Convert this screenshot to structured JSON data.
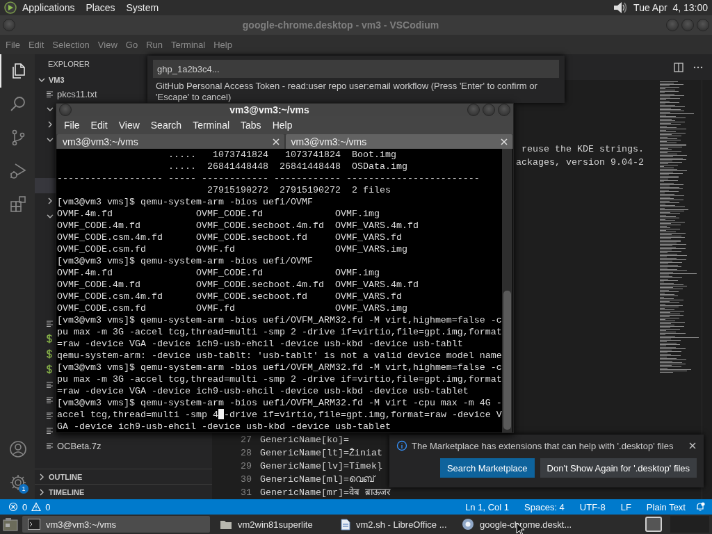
{
  "top_panel": {
    "menus": [
      "Applications",
      "Places",
      "System"
    ],
    "clock": "Tue Apr  4, 13:00"
  },
  "editor_window": {
    "title": "google-chrome.desktop - vm3 - VSCodium",
    "menus": [
      "File",
      "Edit",
      "Selection",
      "View",
      "Go",
      "Run",
      "Terminal",
      "Help"
    ],
    "activity_bar": [
      {
        "kind": "files",
        "selected": true
      },
      {
        "kind": "search",
        "selected": false
      },
      {
        "kind": "source-control",
        "selected": false
      },
      {
        "kind": "run",
        "selected": false
      },
      {
        "kind": "extensions",
        "selected": false
      }
    ],
    "settings_badge": "1",
    "sidebar": {
      "title": "EXPLORER",
      "folder": "VM3",
      "folder_expanded": true,
      "rows": [
        {
          "kind": "file",
          "label": "pkcs11.txt",
          "selected": false
        },
        {
          "kind": "folder",
          "expanded": true,
          "selected": false
        },
        {
          "kind": "folder",
          "expanded": false,
          "selected": false
        },
        {
          "kind": "folder",
          "expanded": true,
          "selected": false
        },
        {
          "kind": "covered",
          "selected": false
        },
        {
          "kind": "covered",
          "selected": false
        },
        {
          "kind": "covered",
          "selected": true
        },
        {
          "kind": "folder",
          "expanded": false,
          "selected": false
        },
        {
          "kind": "folder",
          "expanded": true,
          "selected": false
        },
        {
          "kind": "covered",
          "selected": false
        },
        {
          "kind": "covered",
          "selected": false
        },
        {
          "kind": "covered",
          "selected": false
        },
        {
          "kind": "covered",
          "selected": false
        },
        {
          "kind": "covered",
          "selected": false
        },
        {
          "kind": "covered",
          "selected": false
        },
        {
          "kind": "file",
          "selected": false
        },
        {
          "kind": "shell",
          "selected": false
        },
        {
          "kind": "shell",
          "selected": false
        },
        {
          "kind": "shell",
          "selected": false
        },
        {
          "kind": "file",
          "selected": false
        },
        {
          "kind": "file",
          "selected": false
        },
        {
          "kind": "file",
          "selected": false
        },
        {
          "kind": "file",
          "selected": false
        },
        {
          "kind": "file",
          "label": "OCBeta.7z",
          "selected": false
        }
      ],
      "sections": [
        {
          "label": "OUTLINE",
          "expanded": false
        },
        {
          "label": "TIMELINE",
          "expanded": false
        }
      ]
    },
    "editor": {
      "fragments": [
        "reuse the KDE strings.",
        "ackages, version 9.04-2"
      ],
      "lines": [
        {
          "number": "27",
          "text": "GenericName[ko]="
        },
        {
          "number": "28",
          "text": "GenericName[lt]=Žiniat"
        },
        {
          "number": "29",
          "text": "GenericName[lv]=Tīmekļ"
        },
        {
          "number": "30",
          "text": "GenericName[ml]=വെബ്"
        },
        {
          "number": "31",
          "text": "GenericName[mr]=वेब ब्राऊजर"
        }
      ]
    },
    "quick_input": {
      "value": "ghp_1a2b3c4...",
      "message": "GitHub Personal Access Token - read:user repo user:email workflow (Press 'Enter' to confirm or 'Escape' to cancel)"
    },
    "notification": {
      "message": "The Marketplace has extensions that can help with '.desktop' files",
      "buttons": [
        {
          "label": "Search Marketplace",
          "kind": "primary"
        },
        {
          "label": "Don't Show Again for '.desktop' files",
          "kind": "secondary"
        }
      ]
    },
    "status_bar": {
      "errors": "0",
      "warnings": "0",
      "items": [
        "Ln 1, Col 1",
        "Spaces: 4",
        "UTF-8",
        "LF",
        "Plain Text"
      ]
    }
  },
  "terminal_window": {
    "title": "vm3@vm3:~/vms",
    "menus": [
      "File",
      "Edit",
      "View",
      "Search",
      "Terminal",
      "Tabs",
      "Help"
    ],
    "tabs": [
      {
        "label": "vm3@vm3:~/vms",
        "selected": false
      },
      {
        "label": "vm3@vm3:~/vms",
        "selected": true
      }
    ],
    "lines": [
      {
        "text": "                    .....   1073741824   1073741824  Boot.img",
        "cursor": false
      },
      {
        "text": "                    .....  26841448448  26841448448  OSData.img",
        "cursor": false
      },
      {
        "text": "------------------- ----- ------------ ------------ ------------------------",
        "cursor": false
      },
      {
        "text": "                           27915190272  27915190272  2 files",
        "cursor": false
      },
      {
        "text": "[vm3@vm3 vms]$ qemu-system-arm -bios uefi/OVMF",
        "cursor": false
      },
      {
        "text": "OVMF.4m.fd               OVMF_CODE.fd             OVMF.img",
        "cursor": false
      },
      {
        "text": "OVMF_CODE.4m.fd          OVMF_CODE.secboot.4m.fd  OVMF_VARS.4m.fd",
        "cursor": false
      },
      {
        "text": "OVMF_CODE.csm.4m.fd      OVMF_CODE.secboot.fd     OVMF_VARS.fd",
        "cursor": false
      },
      {
        "text": "OVMF_CODE.csm.fd         OVMF.fd                  OVMF_VARS.img",
        "cursor": false
      },
      {
        "text": "[vm3@vm3 vms]$ qemu-system-arm -bios uefi/OVMF",
        "cursor": false
      },
      {
        "text": "OVMF.4m.fd               OVMF_CODE.fd             OVMF.img",
        "cursor": false
      },
      {
        "text": "OVMF_CODE.4m.fd          OVMF_CODE.secboot.4m.fd  OVMF_VARS.4m.fd",
        "cursor": false
      },
      {
        "text": "OVMF_CODE.csm.4m.fd      OVMF_CODE.secboot.fd     OVMF_VARS.fd",
        "cursor": false
      },
      {
        "text": "OVMF_CODE.csm.fd         OVMF.fd                  OVMF_VARS.img",
        "cursor": false
      },
      {
        "text": "[vm3@vm3 vms]$ qemu-system-arm -bios uefi/OVFM_ARM32.fd -M virt,highmem=false -c",
        "cursor": false
      },
      {
        "text": "pu max -m 3G -accel tcg,thread=multi -smp 2 -drive if=virtio,file=gpt.img,format",
        "cursor": false
      },
      {
        "text": "=raw -device VGA -device ich9-usb-ehcil -device usb-kbd -device usb-tablt",
        "cursor": false
      },
      {
        "text": "qemu-system-arm: -device usb-tablt: 'usb-tablt' is not a valid device model name",
        "cursor": false
      },
      {
        "text": "[vm3@vm3 vms]$ qemu-system-arm -bios uefi/OVFM_ARM32.fd -M virt,highmem=false -c",
        "cursor": false
      },
      {
        "text": "pu max -m 3G -accel tcg,thread=multi -smp 2 -drive if=virtio,file=gpt.img,format",
        "cursor": false
      },
      {
        "text": "=raw -device VGA -device ich9-usb-ehcil -device usb-kbd -device usb-tablet",
        "cursor": false
      },
      {
        "text": "[vm3@vm3 vms]$ qemu-system-arm -bios uefi/OVFM_ARM32.fd -M virt -cpu max -m 4G -",
        "cursor": false
      },
      {
        "text": "accel tcg,thread=multi -smp 4",
        "cursor": true,
        "after_cursor": "-drive if=virtio,file=gpt.img,format=raw -device V"
      },
      {
        "text": "GA -device ich9-usb-ehcil -device usb-kbd -device usb-tablet",
        "cursor": false
      }
    ]
  },
  "taskbar": {
    "tasks": [
      {
        "kind": "terminal",
        "label": "vm3@vm3:~/vms",
        "selected": true
      },
      {
        "kind": "folder",
        "label": "vm2win81superlite",
        "selected": false
      },
      {
        "kind": "document",
        "label": "vm2.sh - LibreOffice ...",
        "selected": false
      },
      {
        "kind": "browser",
        "label": "google-chrome.deskt...",
        "selected": false
      }
    ]
  }
}
